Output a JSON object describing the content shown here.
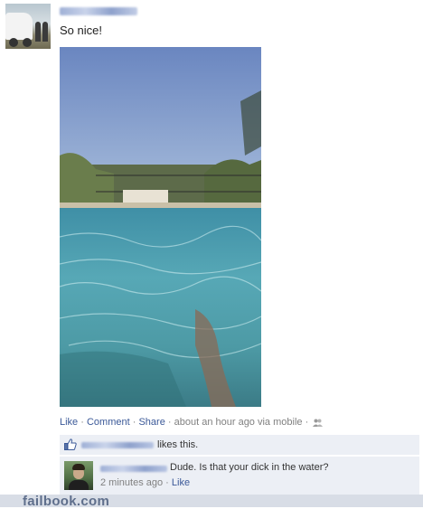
{
  "post": {
    "status": "So nice!"
  },
  "actions": {
    "like": "Like",
    "comment": "Comment",
    "share": "Share",
    "separator": "·",
    "timestamp": "about an hour ago via mobile",
    "privacy_icon": "friends-icon"
  },
  "likes": {
    "icon": "thumbs-up-icon",
    "text": "likes this."
  },
  "comment": {
    "text": "Dude. Is that your dick in the water?",
    "time": "2 minutes ago",
    "like": "Like"
  },
  "watermark": "failbook.com",
  "colors": {
    "link": "#3b5998",
    "meta": "#808080",
    "panel": "#eceff5"
  }
}
